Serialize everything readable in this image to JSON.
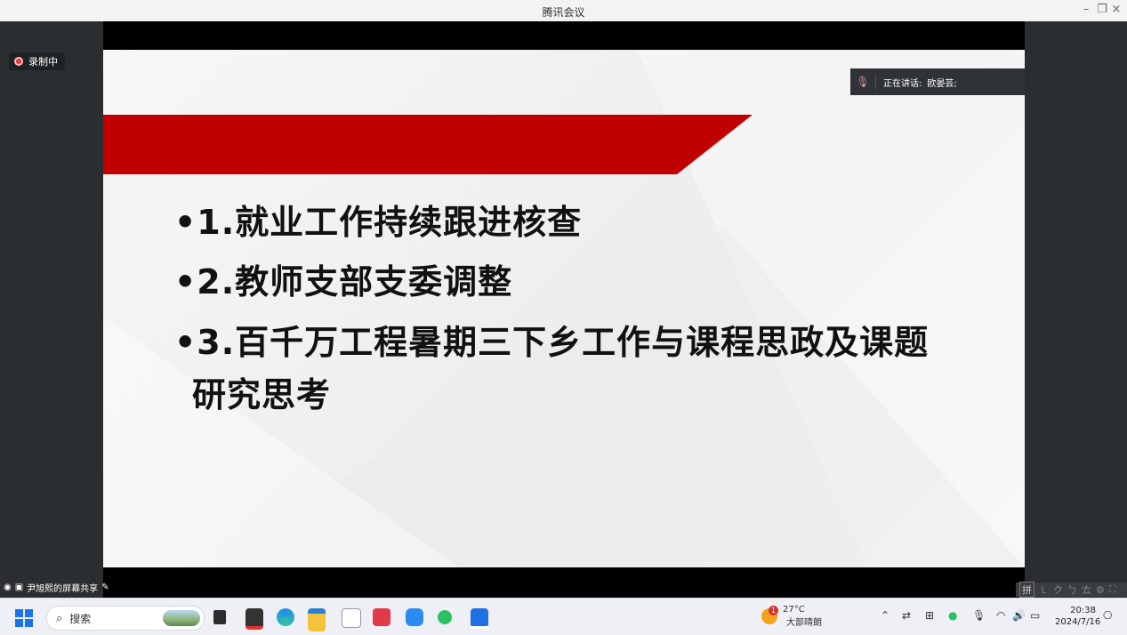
{
  "window": {
    "title": "腾讯会议",
    "controls": {
      "minimize": "–",
      "maximize": "❐",
      "close": "×"
    }
  },
  "meeting": {
    "recording_label": "录制中",
    "speaker_label": "正在讲话:",
    "speaker_name": "欧晏芸;",
    "share_label": "尹旭熙的屏幕共享"
  },
  "slide": {
    "bullets": [
      "•1.就业工作持续跟进核查",
      "•2.教师支部支委调整",
      "•3.百千万工程暑期三下乡工作与课程思政及课题",
      "研究思考"
    ],
    "accent_color": "#c00000"
  },
  "ime_bar": {
    "items": [
      "拼",
      "㇄",
      "ク",
      "ㄅ",
      "ㄊ",
      "⚙",
      "⛶"
    ]
  },
  "taskbar": {
    "search_placeholder": "搜索",
    "weather_temp": "27°C",
    "weather_desc": "大部晴朗",
    "weather_badge": "1",
    "time": "20:38",
    "date": "2024/7/16",
    "icons": [
      "start-icon",
      "task-view-icon",
      "media-player-icon",
      "edge-icon",
      "file-explorer-icon",
      "meeting-app-icon",
      "huawei-store-icon",
      "cloud-drive-icon",
      "wechat-icon",
      "tencent-meeting-icon"
    ],
    "tray_icons": [
      "chevron-up-icon",
      "switch-icon",
      "meeting-tray-icon",
      "wechat-tray-icon",
      "microphone-icon",
      "wifi-icon",
      "volume-icon",
      "battery-icon",
      "notification-icon"
    ]
  }
}
